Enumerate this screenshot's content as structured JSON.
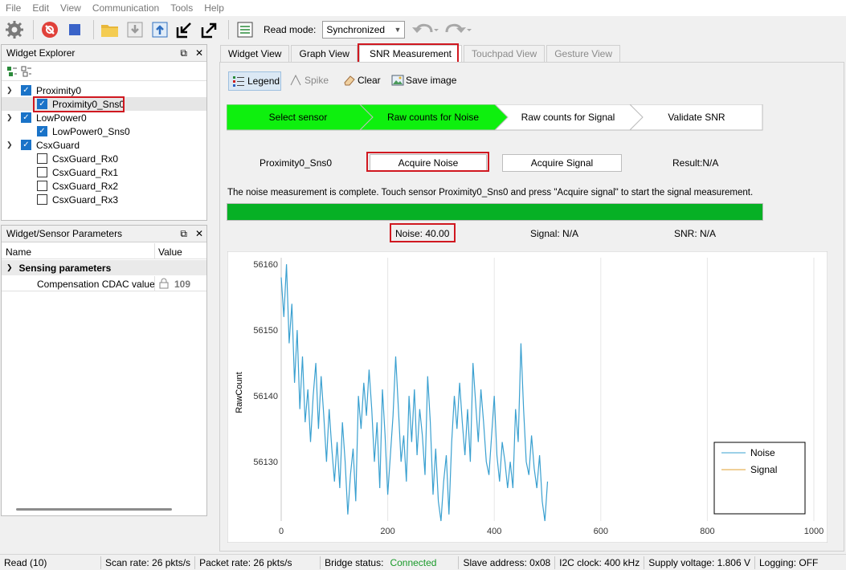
{
  "menu": [
    "File",
    "Edit",
    "View",
    "Communication",
    "Tools",
    "Help"
  ],
  "toolbar": {
    "read_mode_label": "Read mode:",
    "read_mode_value": "Synchronized"
  },
  "widget_explorer": {
    "title": "Widget Explorer",
    "items": [
      {
        "label": "Proximity0"
      },
      {
        "label": "Proximity0_Sns0"
      },
      {
        "label": "LowPower0"
      },
      {
        "label": "LowPower0_Sns0"
      },
      {
        "label": "CsxGuard"
      },
      {
        "label": "CsxGuard_Rx0"
      },
      {
        "label": "CsxGuard_Rx1"
      },
      {
        "label": "CsxGuard_Rx2"
      },
      {
        "label": "CsxGuard_Rx3"
      }
    ]
  },
  "params": {
    "title": "Widget/Sensor Parameters",
    "col_name": "Name",
    "col_value": "Value",
    "group": "Sensing parameters",
    "rows": [
      {
        "name": "Compensation CDAC value",
        "value": "109"
      }
    ]
  },
  "tabs": [
    {
      "label": "Widget View"
    },
    {
      "label": "Graph View"
    },
    {
      "label": "SNR Measurement"
    },
    {
      "label": "Touchpad View"
    },
    {
      "label": "Gesture View"
    }
  ],
  "snr": {
    "legend_label": "Legend",
    "spike_label": "Spike",
    "clear_label": "Clear",
    "save_label": "Save image",
    "steps": [
      "Select sensor",
      "Raw counts for Noise",
      "Raw counts for Signal",
      "Validate SNR"
    ],
    "sensor": "Proximity0_Sns0",
    "acquire_noise": "Acquire Noise",
    "acquire_signal": "Acquire Signal",
    "result": "Result:N/A",
    "message": "The noise measurement is complete. Touch sensor Proximity0_Sns0 and press \"Acquire signal\" to start the signal measurement.",
    "progress": 1.0,
    "noise": "Noise:  40.00",
    "signal": "Signal:  N/A",
    "snr": "SNR:  N/A"
  },
  "chart_data": {
    "type": "line",
    "ylabel": "RawCount",
    "xlim": [
      0,
      1000
    ],
    "ylim": [
      56121,
      56161
    ],
    "xticks": [
      0,
      200,
      400,
      600,
      800,
      1000
    ],
    "yticks": [
      56130,
      56140,
      56150,
      56160
    ],
    "legend": [
      "Noise",
      "Signal"
    ],
    "legend_position": "bottom-right",
    "colors": {
      "Noise": "#3aa0d0",
      "Signal": "#e0a030"
    },
    "series": [
      {
        "name": "Noise",
        "x": [
          0,
          5,
          10,
          15,
          20,
          25,
          30,
          35,
          40,
          45,
          50,
          55,
          60,
          65,
          70,
          75,
          80,
          85,
          90,
          95,
          100,
          105,
          110,
          115,
          120,
          125,
          130,
          135,
          140,
          145,
          150,
          155,
          160,
          165,
          170,
          175,
          180,
          185,
          190,
          195,
          200,
          205,
          210,
          215,
          220,
          225,
          230,
          235,
          240,
          245,
          250,
          255,
          260,
          265,
          270,
          275,
          280,
          285,
          290,
          295,
          300,
          305,
          310,
          315,
          320,
          325,
          330,
          335,
          340,
          345,
          350,
          355,
          360,
          365,
          370,
          375,
          380,
          385,
          390,
          395,
          400,
          405,
          410,
          415,
          420,
          425,
          430,
          435,
          440,
          445,
          450,
          455,
          460,
          465,
          470,
          475,
          480,
          485,
          490,
          495,
          500
        ],
        "y": [
          56158,
          56152,
          56160,
          56148,
          56154,
          56142,
          56150,
          56138,
          56146,
          56136,
          56141,
          56133,
          56140,
          56145,
          56135,
          56143,
          56137,
          56130,
          56138,
          56132,
          56127,
          56133,
          56126,
          56136,
          56130,
          56122,
          56128,
          56132,
          56124,
          56140,
          56135,
          56142,
          56137,
          56144,
          56138,
          56130,
          56136,
          56126,
          56141,
          56134,
          56125,
          56131,
          56137,
          56146,
          56138,
          56130,
          56134,
          56127,
          56140,
          56133,
          56141,
          56131,
          56138,
          56134,
          56128,
          56143,
          56136,
          56125,
          56132,
          56124,
          56121,
          56127,
          56131,
          56122,
          56133,
          56140,
          56135,
          56142,
          56136,
          56131,
          56138,
          56130,
          56145,
          56139,
          56133,
          56141,
          56136,
          56130,
          56128,
          56134,
          56140,
          56131,
          56127,
          56133,
          56130,
          56126,
          56130,
          56126,
          56138,
          56133,
          56148,
          56138,
          56130,
          56128,
          56134,
          56129,
          56126,
          56131,
          56124,
          56121,
          56127
        ]
      },
      {
        "name": "Signal",
        "x": [],
        "y": []
      }
    ]
  },
  "status": {
    "read": "Read (10)",
    "scan_rate": "Scan rate:  26 pkts/s",
    "packet_rate": "Packet rate:  26 pkts/s",
    "bridge_label": "Bridge status:",
    "bridge_value": "Connected",
    "slave_address": "Slave address:  0x08",
    "i2c": "I2C clock:  400 kHz",
    "supply": "Supply voltage:  1.806 V",
    "logging": "Logging:  OFF"
  }
}
